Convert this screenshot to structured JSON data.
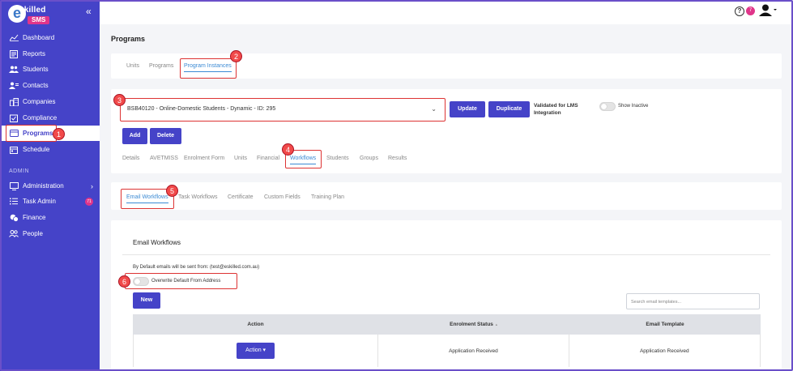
{
  "brand": {
    "logo_letter": "e",
    "logo_text": "skilled",
    "logo_badge": "SMS"
  },
  "sidebar": {
    "items": [
      {
        "label": "Dashboard",
        "icon": "chart-line-icon"
      },
      {
        "label": "Reports",
        "icon": "report-icon"
      },
      {
        "label": "Students",
        "icon": "users-icon"
      },
      {
        "label": "Contacts",
        "icon": "contact-icon"
      },
      {
        "label": "Companies",
        "icon": "building-icon"
      },
      {
        "label": "Compliance",
        "icon": "clipboard-icon"
      },
      {
        "label": "Programs",
        "icon": "program-icon",
        "active": true
      },
      {
        "label": "Schedule",
        "icon": "calendar-icon"
      }
    ],
    "section_admin": "ADMIN",
    "admin_items": [
      {
        "label": "Administration",
        "icon": "monitor-icon"
      },
      {
        "label": "Task Admin",
        "icon": "list-icon",
        "badge": "71"
      },
      {
        "label": "Finance",
        "icon": "coins-icon"
      },
      {
        "label": "People",
        "icon": "people-icon"
      }
    ]
  },
  "header": {
    "help": "?",
    "notifications": "7"
  },
  "page": {
    "title": "Programs"
  },
  "top_tabs": [
    "Units",
    "Programs",
    "Program Instances"
  ],
  "instance": {
    "selected": "BSB40120 - Online-Domestic Students - Dynamic - ID: 295",
    "update_label": "Update",
    "duplicate_label": "Duplicate",
    "validated_line1": "Validated for LMS",
    "validated_line2": "Integration",
    "show_inactive": "Show Inactive",
    "add_label": "Add",
    "delete_label": "Delete"
  },
  "instance_tabs": [
    "Details",
    "AVETMISS",
    "Enrolment Form",
    "Units",
    "Financial",
    "Workflows",
    "Students",
    "Groups",
    "Results"
  ],
  "workflow_tabs": [
    "Email Workflows",
    "Task Workflows",
    "Certificate",
    "Custom Fields",
    "Training Plan"
  ],
  "email": {
    "heading": "Email Workflows",
    "default_from": "By Default emails will be sent from: (test@eskilled.com.au)",
    "overwrite_label": "Overwrite Default From Address",
    "new_label": "New",
    "search_placeholder": "Search email templates..."
  },
  "table": {
    "columns": [
      "Action",
      "Enrolment Status",
      "Email Template"
    ],
    "sort_icon": "▲",
    "rows": [
      {
        "action": "Action ▾",
        "status": "Application Received",
        "template": "Application Received"
      }
    ]
  },
  "callouts": [
    "1",
    "2",
    "3",
    "4",
    "5",
    "6"
  ],
  "colors": {
    "sidebar": "#4543c8",
    "accent": "#3b8ad4",
    "callout": "#f14a4a"
  }
}
